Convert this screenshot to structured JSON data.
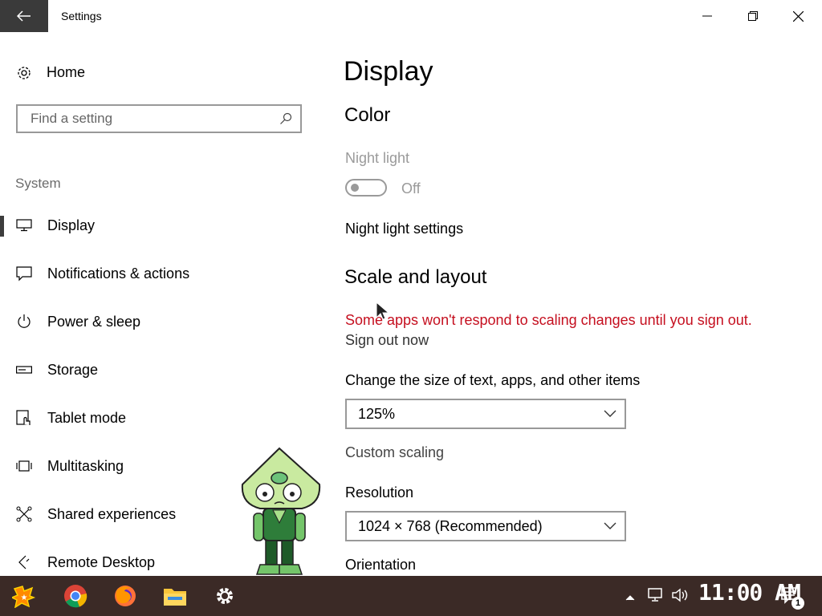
{
  "window": {
    "title": "Settings"
  },
  "sidebar": {
    "home_label": "Home",
    "search_placeholder": "Find a setting",
    "section_label": "System",
    "items": [
      {
        "label": "Display",
        "icon": "monitor-icon",
        "active": true
      },
      {
        "label": "Notifications & actions",
        "icon": "notification-icon"
      },
      {
        "label": "Power & sleep",
        "icon": "power-icon"
      },
      {
        "label": "Storage",
        "icon": "storage-icon"
      },
      {
        "label": "Tablet mode",
        "icon": "tablet-icon"
      },
      {
        "label": "Multitasking",
        "icon": "multitasking-icon"
      },
      {
        "label": "Shared experiences",
        "icon": "shared-icon"
      },
      {
        "label": "Remote Desktop",
        "icon": "remote-desktop-icon"
      }
    ]
  },
  "main": {
    "page_title": "Display",
    "color": {
      "heading": "Color",
      "night_light_label": "Night light",
      "night_light_state": "Off",
      "night_light_settings_link": "Night light settings"
    },
    "scale": {
      "heading": "Scale and layout",
      "warning": "Some apps won't respond to scaling changes until you sign out.",
      "sign_out_link": "Sign out now",
      "size_label": "Change the size of text, apps, and other items",
      "size_value": "125%",
      "custom_scaling_link": "Custom scaling",
      "resolution_label": "Resolution",
      "resolution_value": "1024 × 768 (Recommended)",
      "orientation_label": "Orientation"
    }
  },
  "taskbar": {
    "apps": [
      "start-app-icon",
      "chrome-icon",
      "firefox-icon",
      "file-explorer-icon",
      "settings-gear-icon"
    ],
    "clock": "11:00 AM",
    "notification_count": "1"
  },
  "colors": {
    "warning": "#c50f1f",
    "accent_bar": "#3d3d3d",
    "taskbar_bg": "#3b2a26",
    "back_button_bg": "#3a3a3a"
  }
}
